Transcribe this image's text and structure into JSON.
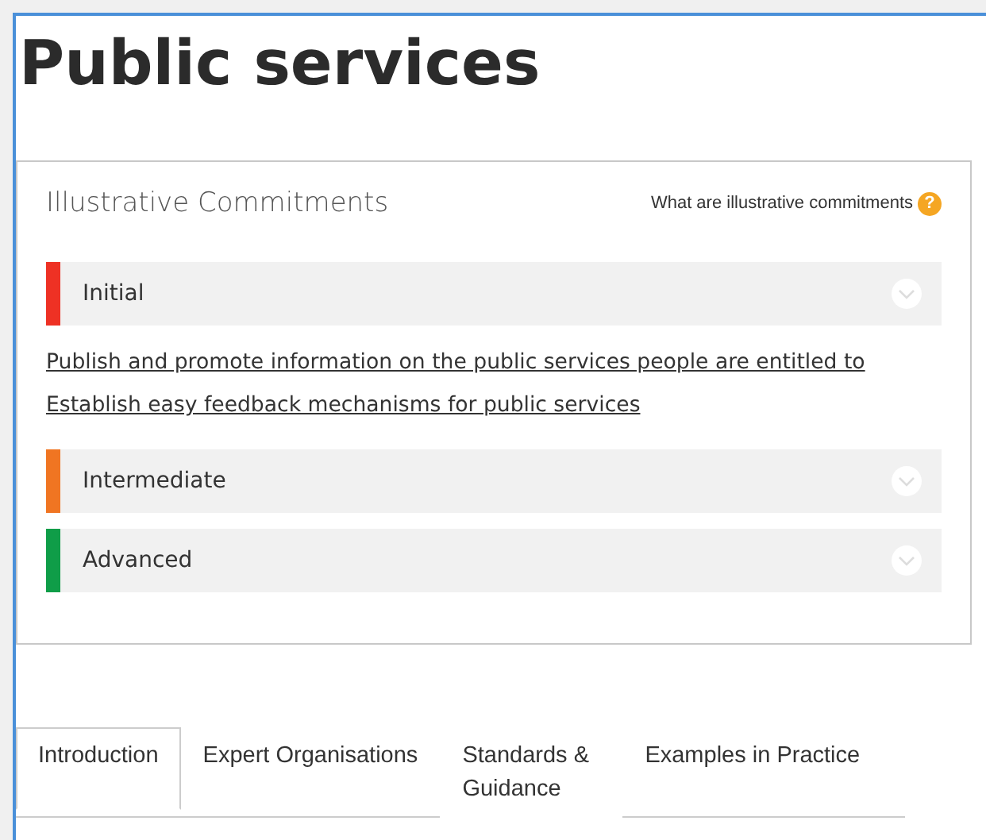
{
  "title": "Public services",
  "card": {
    "heading": "Illustrative Commitments",
    "help_link": "What are illustrative commitments",
    "help_icon": "?",
    "levels": [
      {
        "label": "Initial",
        "color": "#ee3124",
        "links": [
          "Publish and promote information on the public services people are entitled to",
          "Establish easy feedback mechanisms for public services"
        ]
      },
      {
        "label": "Intermediate",
        "color": "#f07522"
      },
      {
        "label": "Advanced",
        "color": "#0f9d48"
      }
    ]
  },
  "tabs": [
    {
      "label": "Introduction",
      "selected": true
    },
    {
      "label": "Expert Organisations",
      "selected": false
    },
    {
      "label": "Standards & Guidance",
      "selected": false
    },
    {
      "label": "Examples in Practice",
      "selected": false
    }
  ]
}
